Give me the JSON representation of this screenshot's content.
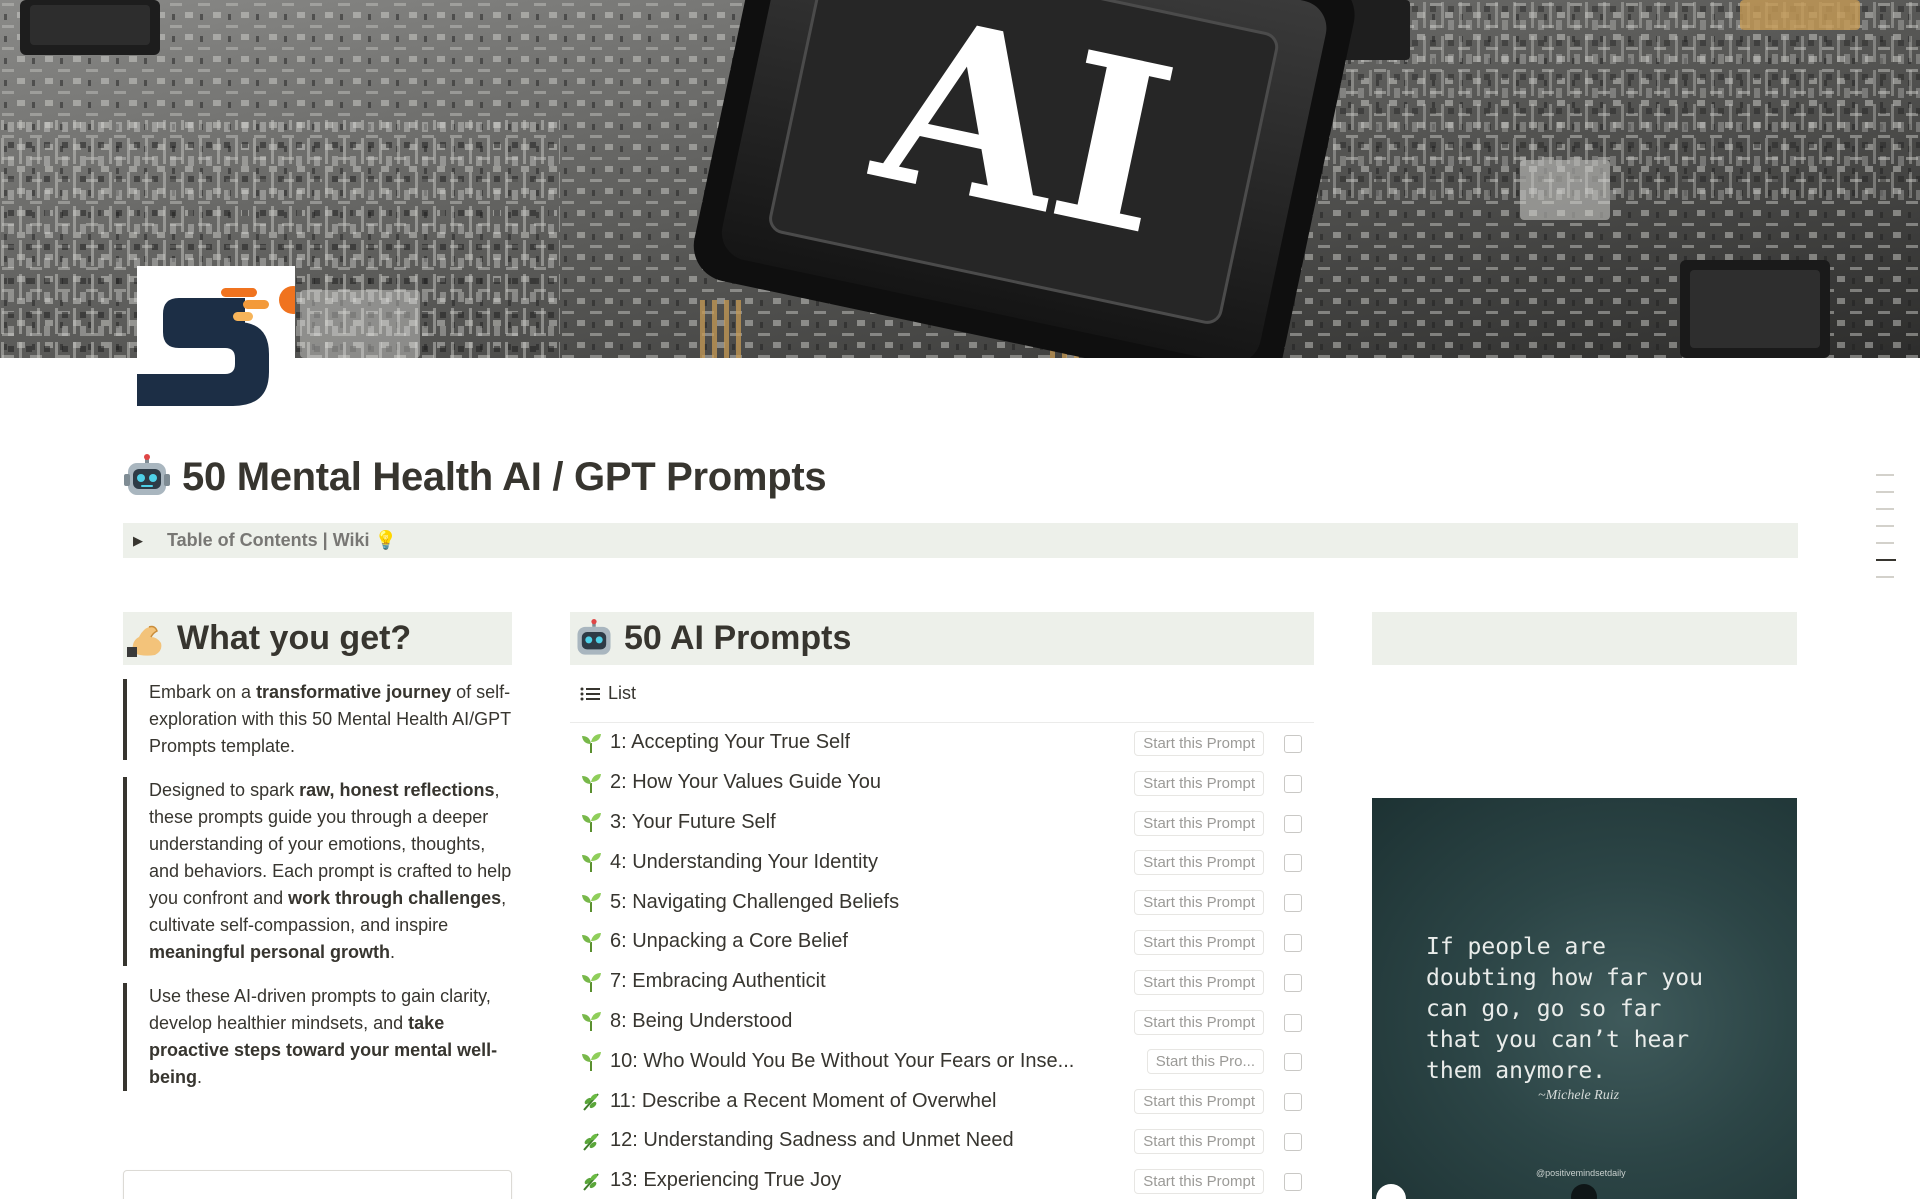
{
  "cover": {
    "chip_text": "AI"
  },
  "page": {
    "icon_letter": "S",
    "title": "50 Mental Health AI / GPT Prompts",
    "title_emoji": "robot-emoji"
  },
  "toc": {
    "label": "Table of Contents | Wiki 💡"
  },
  "what_you_get": {
    "heading": "What you get?",
    "heading_emoji": "flexed-biceps-emoji",
    "p1": {
      "a": "Embark on a ",
      "b": "transformative journey",
      "c": " of self-exploration with this 50 Mental Health AI/GPT Prompts template."
    },
    "p2": {
      "a": "Designed to spark ",
      "b": "raw, honest reflections",
      "c": ", these prompts guide you through a deeper understanding of your emotions, thoughts, and behaviors. Each prompt is crafted to help you confront and ",
      "d": "work through challenges",
      "e": ", cultivate self-compassion, and inspire ",
      "f": "meaningful personal growth",
      "g": "."
    },
    "p3": {
      "a": "Use these AI-driven prompts to gain clarity, develop healthier mindsets, and ",
      "b": "take proactive steps toward your mental well-being",
      "c": "."
    }
  },
  "prompts": {
    "heading": "50 AI Prompts",
    "heading_emoji": "robot-emoji",
    "view_label": "List",
    "rows": [
      {
        "title": "1: Accepting Your True Self",
        "emoji": "seedling-emoji",
        "button": "Start this Prompt",
        "checked": false
      },
      {
        "title": "2: How Your Values Guide You",
        "emoji": "seedling-emoji",
        "button": "Start this Prompt",
        "checked": false
      },
      {
        "title": "3: Your Future Self",
        "emoji": "seedling-emoji",
        "button": "Start this Prompt",
        "checked": false
      },
      {
        "title": "4: Understanding Your Identity",
        "emoji": "seedling-emoji",
        "button": "Start this Prompt",
        "checked": false
      },
      {
        "title": "5: Navigating Challenged Beliefs",
        "emoji": "seedling-emoji",
        "button": "Start this Prompt",
        "checked": false
      },
      {
        "title": "6: Unpacking a Core Belief",
        "emoji": "seedling-emoji",
        "button": "Start this Prompt",
        "checked": false
      },
      {
        "title": "7: Embracing Authenticit",
        "emoji": "seedling-emoji",
        "button": "Start this Prompt",
        "checked": false
      },
      {
        "title": "8: Being Understood",
        "emoji": "seedling-emoji",
        "button": "Start this Prompt",
        "checked": false
      },
      {
        "title": "10: Who Would You Be Without Your Fears or Inse...",
        "emoji": "seedling-emoji",
        "button": "Start this Pro...",
        "checked": false
      },
      {
        "title": "11: Describe a Recent Moment of Overwhel",
        "emoji": "herb-emoji",
        "button": "Start this Prompt",
        "checked": false
      },
      {
        "title": "12: Understanding Sadness and Unmet Need",
        "emoji": "herb-emoji",
        "button": "Start this Prompt",
        "checked": false
      },
      {
        "title": "13: Experiencing True Joy",
        "emoji": "herb-emoji",
        "button": "Start this Prompt",
        "checked": false
      }
    ]
  },
  "quote_card": {
    "text": "If people are\ndoubting how far you\ncan go, go so far\nthat you can’t hear\nthem anymore.",
    "author": "~Michele Ruiz",
    "handle": "@positivemindsetdaily"
  },
  "colors": {
    "text": "#37352f",
    "muted": "#787774",
    "callout_bg": "#edf0ea",
    "button_text": "#9b9a97",
    "logo_navy": "#1c2e45",
    "logo_orange": "#f0731f"
  }
}
